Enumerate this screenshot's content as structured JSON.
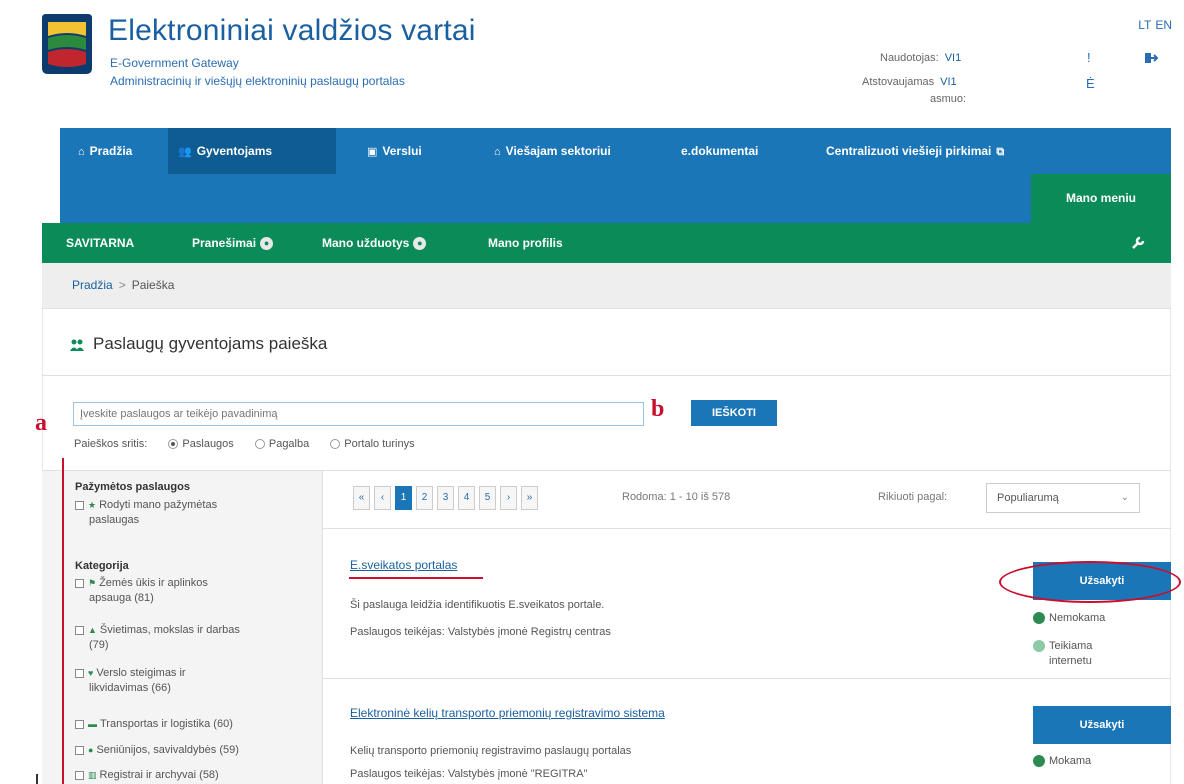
{
  "header": {
    "title": "Elektroniniai valdžios vartai",
    "subtitle_en": "E-Government Gateway",
    "subtitle_lt": "Administracinių ir viešųjų elektroninių paslaugų portalas",
    "user_label": "Naudotojas:",
    "user_value": "VI1",
    "rep_label": "Atstovaujamas",
    "rep_value": "VI1",
    "rep_label2": "asmuo:",
    "lang_lt": "LT",
    "lang_en": "EN",
    "mini1": "!",
    "mini2": "Ė"
  },
  "nav": {
    "items": [
      "Pradžia",
      "Gyventojams",
      "Verslui",
      "Viešajam sektoriui",
      "e.dokumentai",
      "Centralizuoti viešieji pirkimai"
    ],
    "active": "Gyventojams",
    "mano_meniu": "Mano meniu"
  },
  "subnav": {
    "items": [
      "SAVITARNA",
      "Pranešimai",
      "Mano užduotys",
      "Mano profilis"
    ]
  },
  "breadcrumb": {
    "home": "Pradžia",
    "sep": ">",
    "current": "Paieška"
  },
  "page": {
    "title": "Paslaugų gyventojams paieška",
    "search_placeholder": "Įveskite paslaugos ar teikėjo pavadinimą",
    "search_button": "IEŠKOTI",
    "scope_label": "Paieškos sritis:",
    "scope_options": [
      "Paslaugos",
      "Pagalba",
      "Portalo turinys"
    ]
  },
  "sidebar": {
    "marked_heading": "Pažymėtos paslaugos",
    "marked_line1": "Rodyti mano pažymėtas",
    "marked_line2": "paslaugas",
    "category_heading": "Kategorija",
    "categories": [
      {
        "line1": "Žemės ūkis ir aplinkos",
        "line2": "apsauga (81)"
      },
      {
        "line1": "Švietimas, mokslas ir darbas",
        "line2": "(79)"
      },
      {
        "line1": "Verslo steigimas ir",
        "line2": "likvidavimas (66)"
      },
      {
        "line1": "Transportas ir logistika (60)",
        "line2": ""
      },
      {
        "line1": "Seniūnijos, savivaldybės (59)",
        "line2": ""
      },
      {
        "line1": "Registrai ir archyvai (58)",
        "line2": ""
      }
    ]
  },
  "results": {
    "pager": [
      "«",
      "‹",
      "1",
      "2",
      "3",
      "4",
      "5",
      "›",
      "»"
    ],
    "shown": "Rodoma: 1 - 10 iš 578",
    "sort_label": "Rikiuoti pagal:",
    "sort_value": "Populiarumą",
    "items": [
      {
        "title": "E.sveikatos portalas",
        "desc": "Ši paslauga leidžia identifikuotis E.sveikatos portale.",
        "provider": "Paslaugos teikėjas: Valstybės įmonė Registrų centras",
        "button": "Užsakyti",
        "tag1": "Nemokama",
        "tag2a": "Teikiama",
        "tag2b": "internetu"
      },
      {
        "title": "Elektroninė kelių transporto priemonių registravimo sistema",
        "desc": "Kelių transporto priemonių registravimo paslaugų portalas",
        "provider": "Paslaugos teikėjas: Valstybės įmonė \"REGITRA\"",
        "button": "Užsakyti",
        "tag1": "Mokama"
      }
    ]
  },
  "annotations": {
    "a": "a",
    "b": "b"
  },
  "colors": {
    "blue": "#1b76b8",
    "green": "#0a8b57",
    "annotation_red": "#c8102e"
  }
}
